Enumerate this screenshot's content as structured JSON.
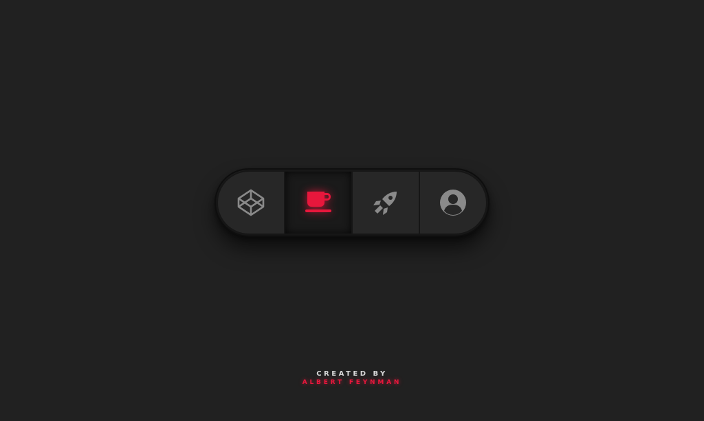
{
  "toolbar": {
    "items": [
      {
        "icon": "codepen-icon",
        "active": false
      },
      {
        "icon": "coffee-cup-icon",
        "active": true
      },
      {
        "icon": "rocket-icon",
        "active": false
      },
      {
        "icon": "user-circle-icon",
        "active": false
      }
    ]
  },
  "colors": {
    "background": "#212121",
    "accent": "#e8173c",
    "icon_inactive": "#8a8a8a"
  },
  "credit": {
    "line1": "CREATED BY",
    "line2": "ALBERT FEYNMAN"
  }
}
